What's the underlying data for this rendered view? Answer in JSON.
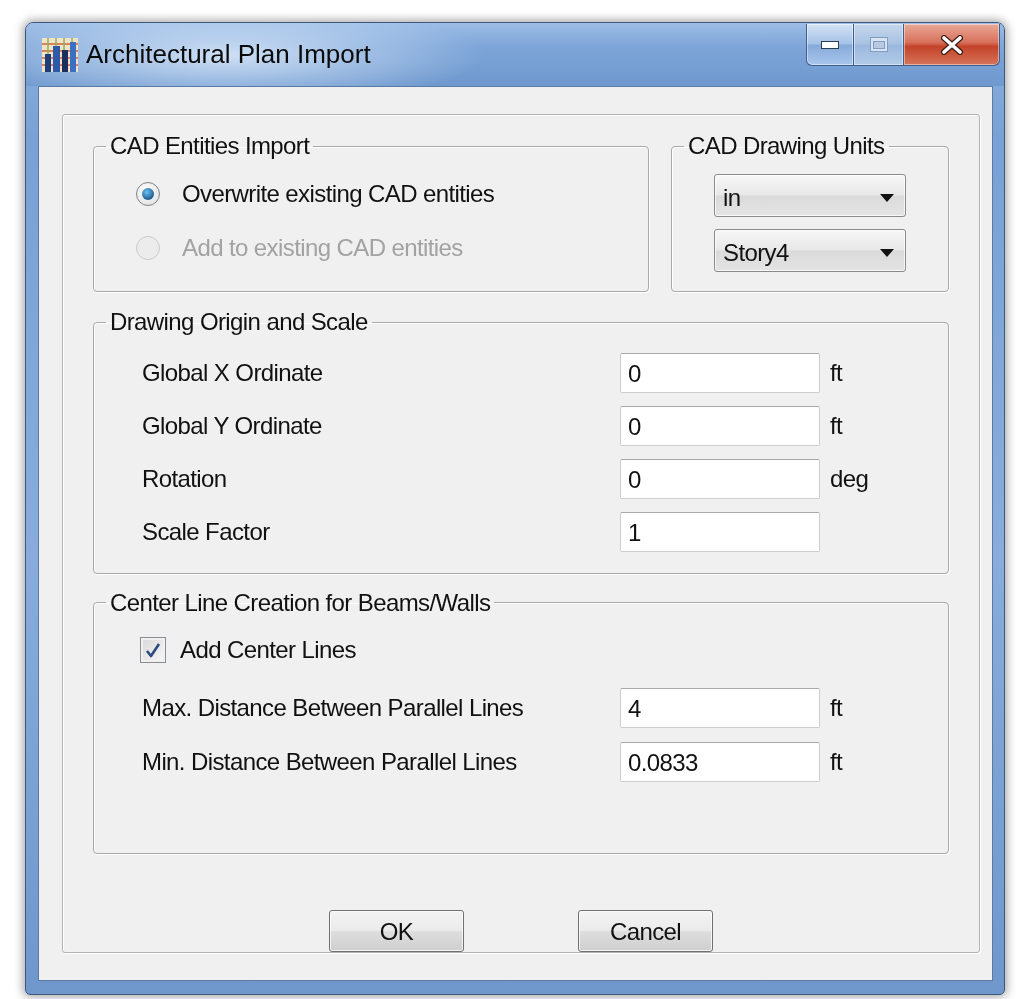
{
  "window": {
    "title": "Architectural Plan Import",
    "caption_buttons": [
      {
        "kind": "minimize",
        "disabled": false
      },
      {
        "kind": "maximize",
        "disabled": true
      },
      {
        "kind": "close",
        "disabled": false
      }
    ]
  },
  "cad_entities_import": {
    "title": "CAD Entities Import",
    "options": [
      {
        "label": "Overwrite existing CAD entities",
        "selected": true,
        "disabled": false
      },
      {
        "label": "Add to existing CAD entities",
        "selected": false,
        "disabled": true
      }
    ]
  },
  "cad_drawing_units": {
    "title": "CAD Drawing Units",
    "dropdowns": [
      {
        "value": "in"
      },
      {
        "value": "Story4"
      }
    ]
  },
  "drawing_origin_and_scale": {
    "title": "Drawing Origin and Scale",
    "fields": [
      {
        "label": "Global X Ordinate",
        "value": "0",
        "unit": "ft"
      },
      {
        "label": "Global Y Ordinate",
        "value": "0",
        "unit": "ft"
      },
      {
        "label": "Rotation",
        "value": "0",
        "unit": "deg"
      },
      {
        "label": "Scale Factor",
        "value": "1"
      }
    ]
  },
  "center_line_creation": {
    "title": "Center Line Creation for Beams/Walls",
    "checkbox": {
      "label": "Add Center Lines",
      "checked": true
    },
    "fields": [
      {
        "label": "Max. Distance Between Parallel Lines",
        "value": "4",
        "unit": "ft"
      },
      {
        "label": "Min. Distance Between Parallel Lines",
        "value": "0.0833",
        "unit": "ft"
      }
    ]
  },
  "buttons": [
    {
      "label": "OK"
    },
    {
      "label": "Cancel"
    }
  ]
}
